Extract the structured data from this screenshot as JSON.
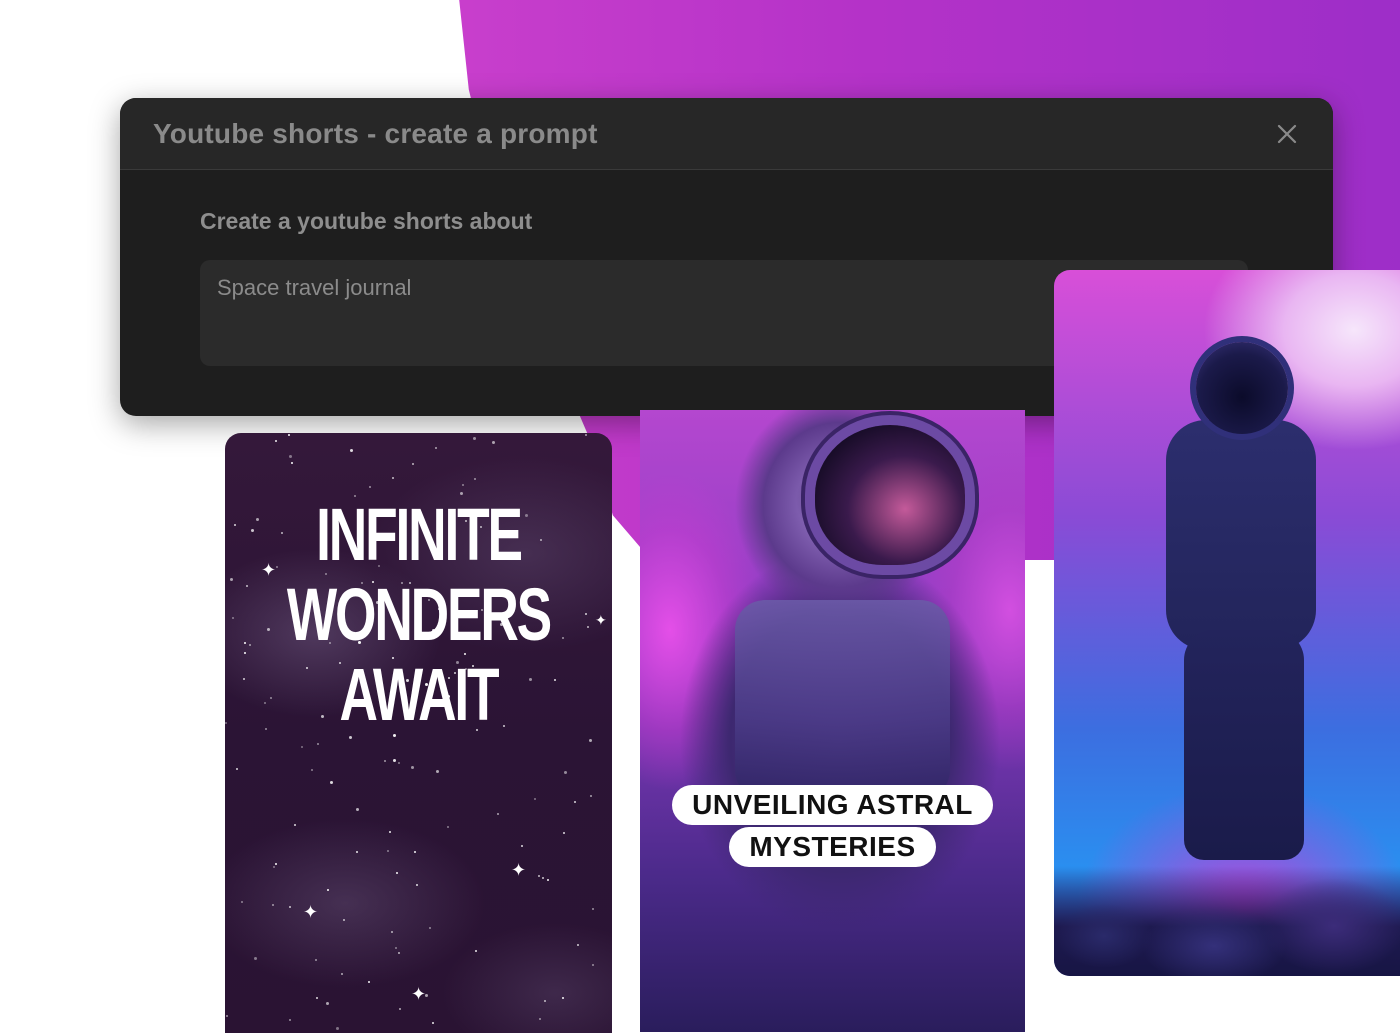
{
  "dialog": {
    "title": "Youtube shorts - create a prompt",
    "close_icon": "close-icon",
    "field_label": "Create a youtube shorts about",
    "field_placeholder": "Space travel journal"
  },
  "cards": [
    {
      "title_lines": [
        "INFINITE",
        "WONDERS",
        "AWAIT"
      ]
    },
    {
      "caption_lines": [
        "UNVEILING ASTRAL",
        "MYSTERIES"
      ]
    },
    {
      "caption_lines": []
    }
  ],
  "colors": {
    "accent_purple": "#b432c8",
    "dialog_bg": "#1e1e1e",
    "dialog_header_bg": "#272727",
    "input_bg": "#2b2b2b",
    "muted_text": "#8a8a8a"
  }
}
